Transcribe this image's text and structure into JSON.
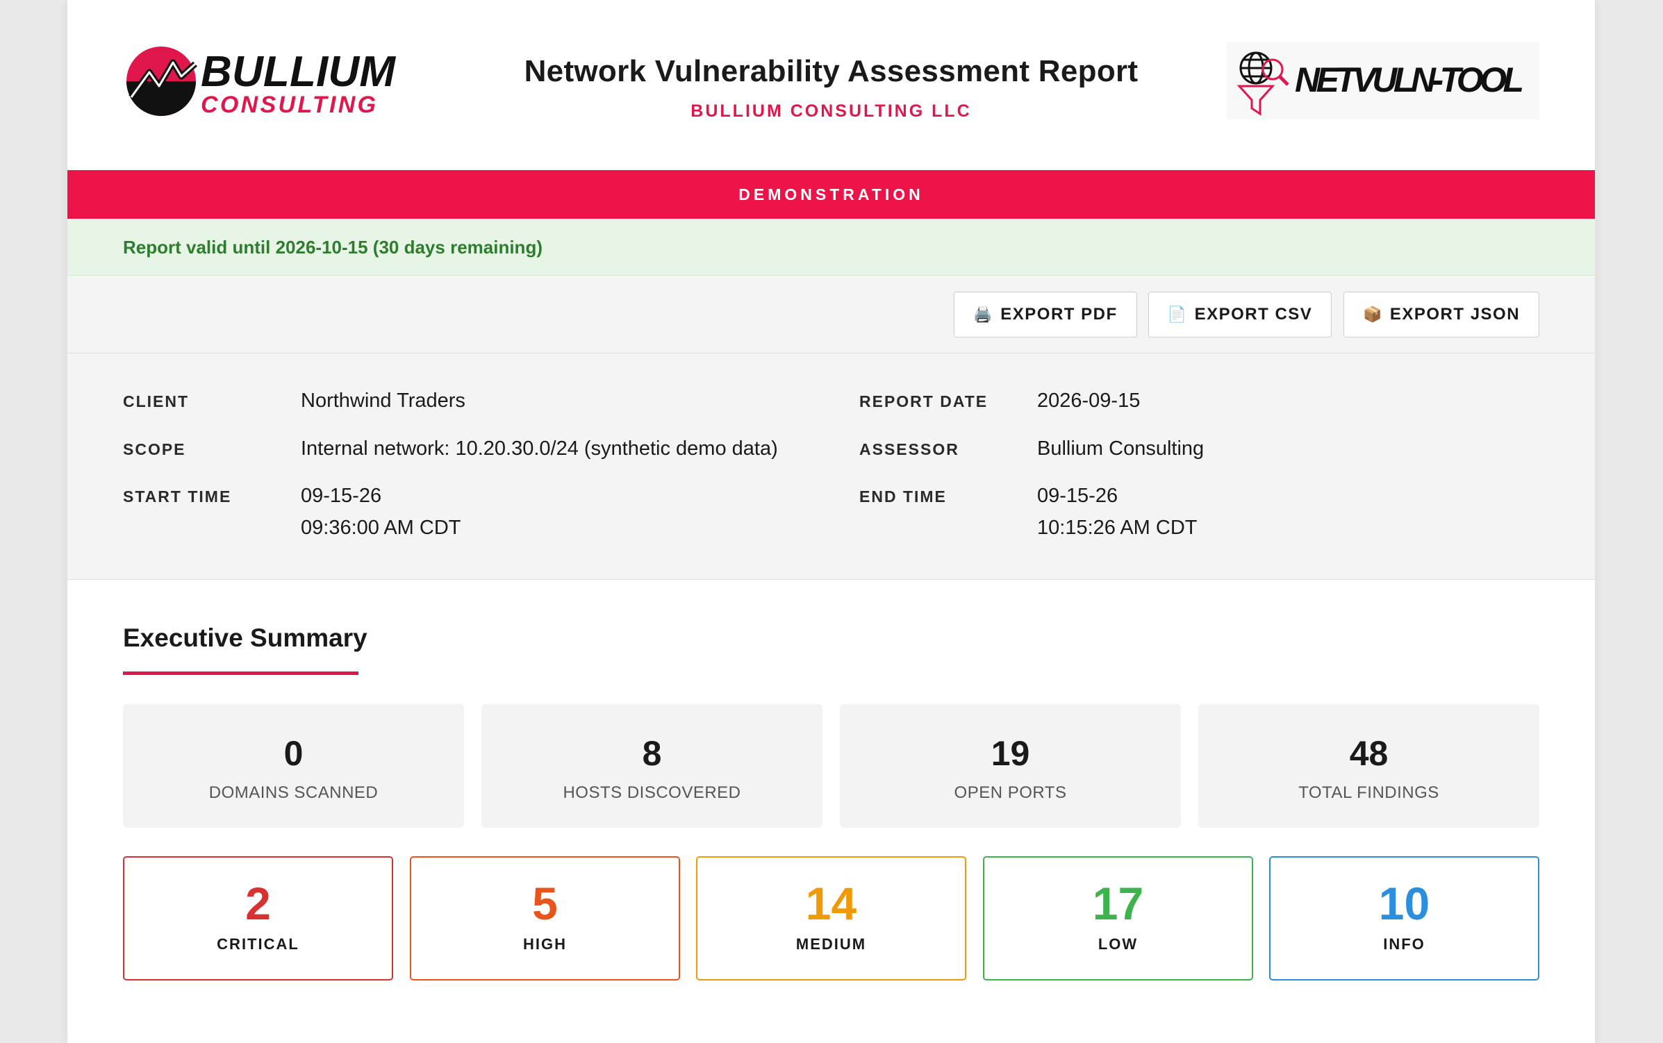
{
  "header": {
    "title": "Network Vulnerability Assessment Report",
    "company": "BULLIUM CONSULTING LLC",
    "brand_logo": {
      "line1": "BULLIUM",
      "line2": "CONSULTING",
      "icon": "bull-emblem-icon"
    },
    "tool_logo": {
      "text": "NETVULN-TOOL",
      "icon": "globe-funnel-magnifier-icon"
    }
  },
  "banner": {
    "text": "DEMONSTRATION"
  },
  "validity": {
    "text": "Report valid until 2026-10-15 (30 days remaining)"
  },
  "toolbar": {
    "export_pdf": "EXPORT PDF",
    "export_csv": "EXPORT CSV",
    "export_json": "EXPORT JSON",
    "pdf_icon": "🖨️",
    "csv_icon": "📄",
    "json_icon": "📦"
  },
  "meta": {
    "client_label": "CLIENT",
    "client": "Northwind Traders",
    "scope_label": "SCOPE",
    "scope": "Internal network: 10.20.30.0/24 (synthetic demo data)",
    "start_label": "START TIME",
    "start_date": "09-15-26",
    "start_time": "09:36:00 AM CDT",
    "report_date_label": "REPORT DATE",
    "report_date": "2026-09-15",
    "assessor_label": "ASSESSOR",
    "assessor": "Bullium Consulting",
    "end_label": "END TIME",
    "end_date": "09-15-26",
    "end_time": "10:15:26 AM CDT"
  },
  "summary": {
    "title": "Executive Summary",
    "stats": [
      {
        "value": "0",
        "label": "DOMAINS SCANNED"
      },
      {
        "value": "8",
        "label": "HOSTS DISCOVERED"
      },
      {
        "value": "19",
        "label": "OPEN PORTS"
      },
      {
        "value": "48",
        "label": "TOTAL FINDINGS"
      }
    ],
    "severity": [
      {
        "value": "2",
        "label": "CRITICAL",
        "color": "#d63232"
      },
      {
        "value": "5",
        "label": "HIGH",
        "color": "#e8541a"
      },
      {
        "value": "14",
        "label": "MEDIUM",
        "color": "#f09a0a"
      },
      {
        "value": "17",
        "label": "LOW",
        "color": "#3cb44b"
      },
      {
        "value": "10",
        "label": "INFO",
        "color": "#2b8fde"
      }
    ]
  },
  "colors": {
    "accent": "#e0174d",
    "banner": "#ec1349",
    "valid_text": "#2e7d2e"
  }
}
